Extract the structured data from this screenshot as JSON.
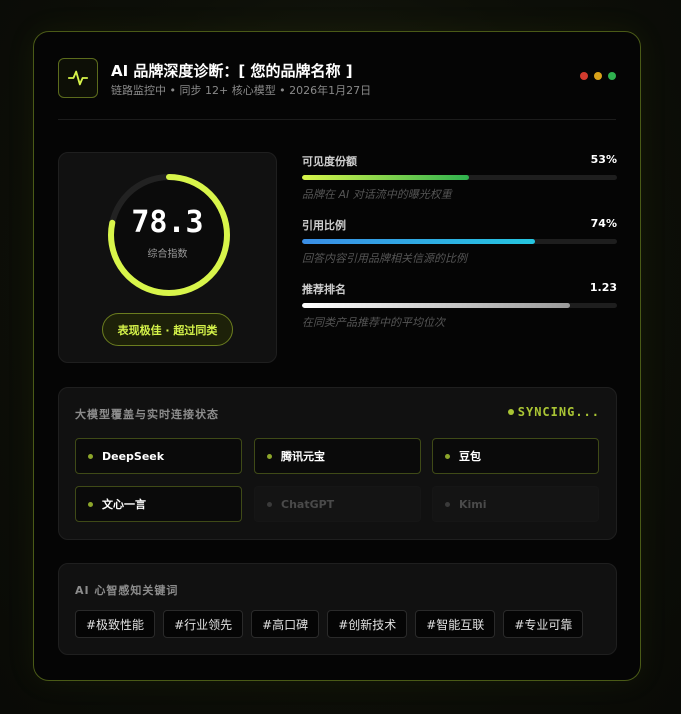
{
  "header": {
    "title": "AI 品牌深度诊断：[ 您的品牌名称 ]",
    "subtitle": "链路监控中 • 同步 12+ 核心模型 • 2026年1月27日",
    "logo_icon": "pulse-icon",
    "window_dots": [
      "#d23b2e",
      "#d9a21a",
      "#2fb24f"
    ]
  },
  "score": {
    "value": "78.3",
    "label": "综合指数",
    "percent": 78.3,
    "badge": "表现极佳 · 超过同类",
    "ring_color": "#d8f54a"
  },
  "metrics": [
    {
      "name": "可见度份额",
      "value": "53%",
      "fill": 0.53,
      "desc": "品牌在 AI 对话流中的曝光权重",
      "gradient": [
        "#d8f54a",
        "#2fb24f"
      ]
    },
    {
      "name": "引用比例",
      "value": "74%",
      "fill": 0.74,
      "desc": "回答内容引用品牌相关信源的比例",
      "gradient": [
        "#3a8ee6",
        "#25c6e0"
      ]
    },
    {
      "name": "推荐排名",
      "value": "1.23",
      "fill": 0.85,
      "desc": "在同类产品推荐中的平均位次",
      "gradient": [
        "#ffffff",
        "#9a9a9a"
      ]
    }
  ],
  "models": {
    "title": "大模型覆盖与实时连接状态",
    "status": "SYNCING...",
    "items": [
      {
        "name": "DeepSeek",
        "active": true
      },
      {
        "name": "腾讯元宝",
        "active": true
      },
      {
        "name": "豆包",
        "active": true
      },
      {
        "name": "文心一言",
        "active": true
      },
      {
        "name": "ChatGPT",
        "active": false
      },
      {
        "name": "Kimi",
        "active": false
      }
    ]
  },
  "keywords": {
    "title": "AI 心智感知关键词",
    "tags": [
      "#极致性能",
      "#行业领先",
      "#高口碑",
      "#创新技术",
      "#智能互联",
      "#专业可靠"
    ]
  }
}
